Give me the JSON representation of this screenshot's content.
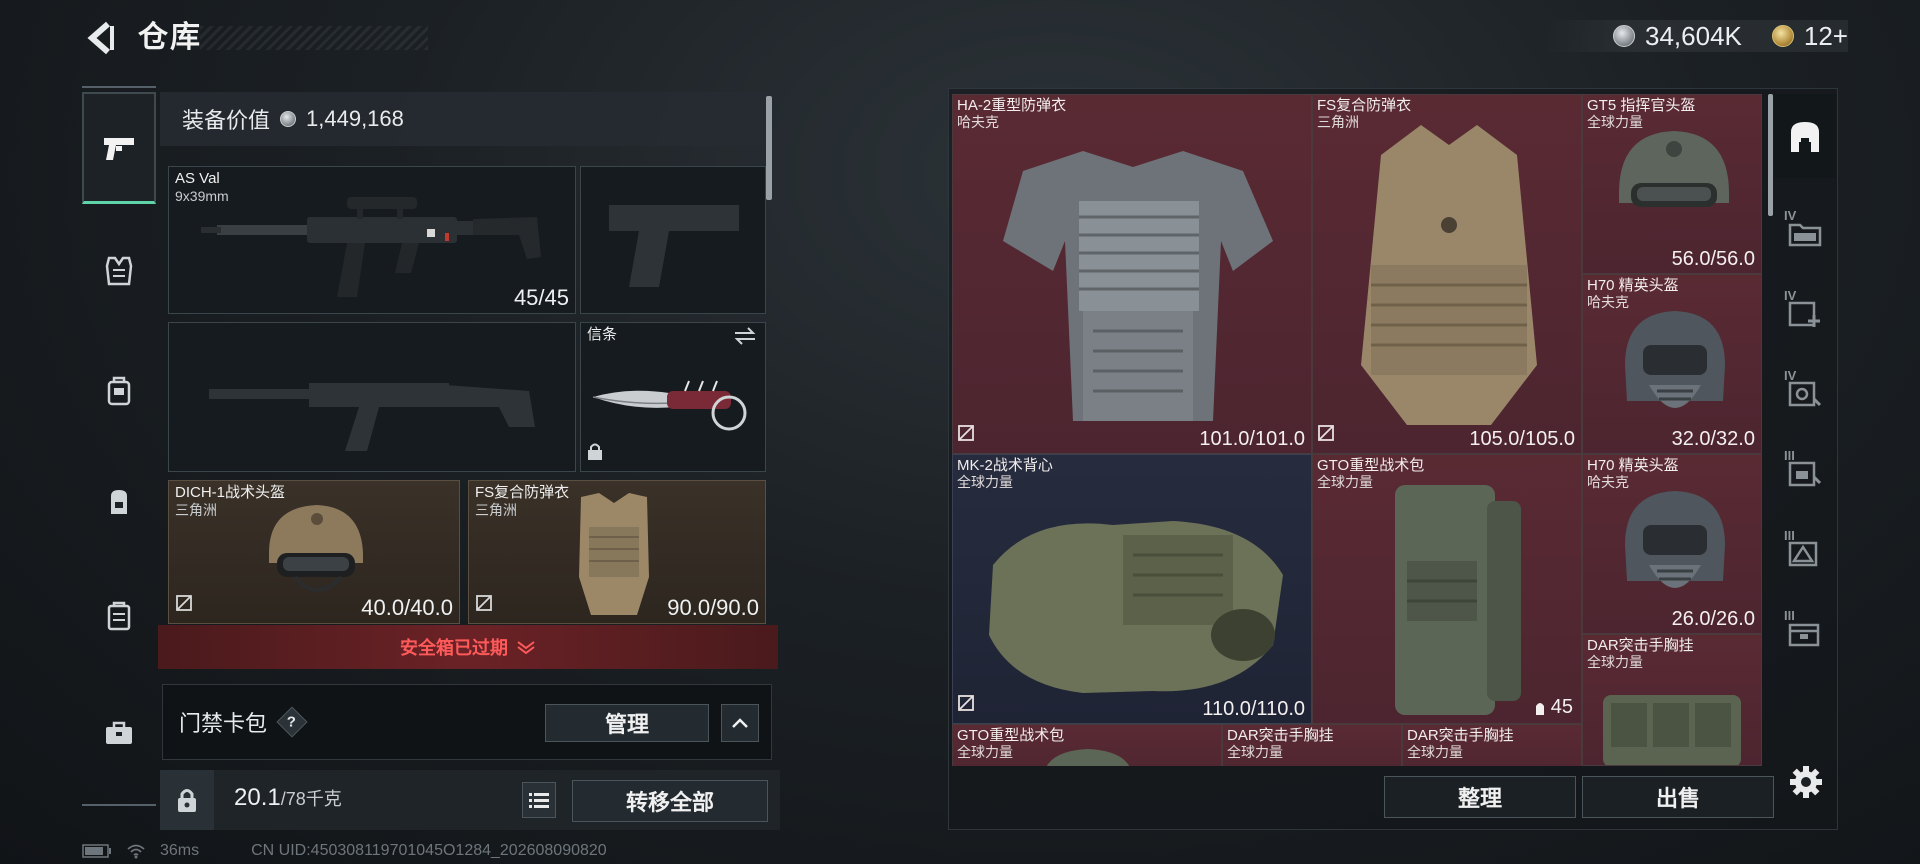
{
  "header": {
    "title": "仓库",
    "currency_silver": "34,604K",
    "currency_gold": "12+"
  },
  "left_rail": {
    "items": [
      "weapons-icon",
      "armor-icon",
      "backpack-icon",
      "chest-rig-icon",
      "container-icon",
      "briefcase-icon"
    ]
  },
  "loadout": {
    "equip_value_label": "装备价值",
    "equip_value": "1,449,168",
    "primary_weapon": {
      "name": "AS Val",
      "caliber": "9x39mm",
      "ammo": "45/45"
    },
    "melee": {
      "name": "信条"
    },
    "helmet": {
      "name": "DICH-1战术头盔",
      "faction": "三角洲",
      "durability": "40.0/40.0"
    },
    "armor": {
      "name": "FS复合防弹衣",
      "faction": "三角洲",
      "durability": "90.0/90.0"
    },
    "safe_box_status": "安全箱已过期",
    "keycard_label": "门禁卡包",
    "keycard_help": "?",
    "manage_button": "管理",
    "weight_current": "20.1",
    "weight_max": "/78千克",
    "transfer_all_button": "转移全部"
  },
  "status": {
    "ping": "36ms",
    "uid": "CN UID:450308119701045O1284_202608090820"
  },
  "stash": {
    "items": [
      {
        "name": "HA-2重型防弹衣",
        "sub": "哈夫克",
        "durability": "101.0/101.0"
      },
      {
        "name": "FS复合防弹衣",
        "sub": "三角洲",
        "durability": "105.0/105.0"
      },
      {
        "name": "GT5 指挥官头盔",
        "sub": "全球力量",
        "durability": "56.0/56.0"
      },
      {
        "name": "H70 精英头盔",
        "sub": "哈夫克",
        "durability": "32.0/32.0"
      },
      {
        "name": "MK-2战术背心",
        "sub": "全球力量",
        "durability": "110.0/110.0"
      },
      {
        "name": "GTO重型战术包",
        "sub": "全球力量",
        "count": "45"
      },
      {
        "name": "H70 精英头盔",
        "sub": "哈夫克",
        "durability": "26.0/26.0"
      },
      {
        "name": "DAR突击手胸挂",
        "sub": "全球力量"
      },
      {
        "name": "GTO重型战术包",
        "sub": "全球力量"
      },
      {
        "name": "DAR突击手胸挂",
        "sub": "全球力量"
      },
      {
        "name": "DAR突击手胸挂",
        "sub": "全球力量"
      }
    ],
    "tidy_button": "整理",
    "sell_button": "出售",
    "tabs": [
      {
        "icon": "stash-home-icon",
        "tier": ""
      },
      {
        "icon": "folder-icon",
        "tier": "IV"
      },
      {
        "icon": "add-page-icon",
        "tier": "IV"
      },
      {
        "icon": "search-page-icon",
        "tier": "IV"
      },
      {
        "icon": "tag-icon",
        "tier": "III"
      },
      {
        "icon": "warning-page-icon",
        "tier": "III"
      },
      {
        "icon": "box-icon",
        "tier": "III"
      }
    ]
  }
}
